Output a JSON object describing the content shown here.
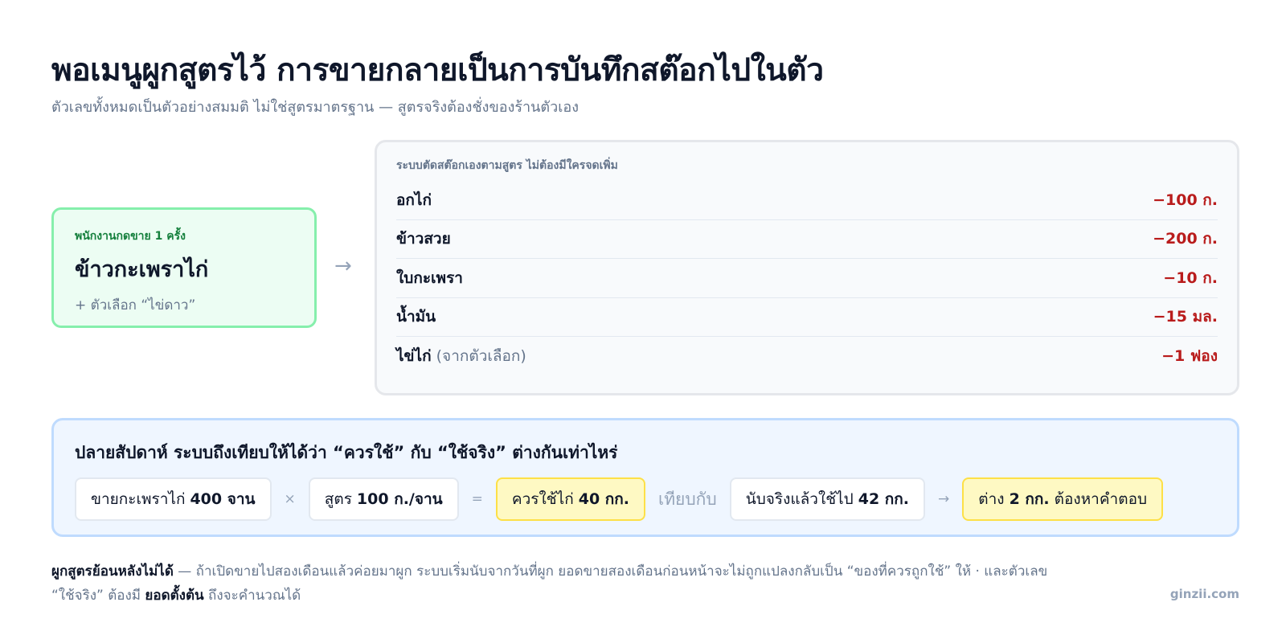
{
  "header": {
    "title": "พอเมนูผูกสูตรไว้ การขายกลายเป็นการบันทึกสต๊อกไปในตัว",
    "subtitle": "ตัวเลขทั้งหมดเป็นตัวอย่างสมมติ ไม่ใช่สูตรมาตรฐาน — สูตรจริงต้องชั่งของร้านตัวเอง"
  },
  "sale": {
    "kicker": "พนักงานกดขาย 1 ครั้ง",
    "dish": "ข้าวกะเพราไก่",
    "option": "+ ตัวเลือก “ไข่ดาว”",
    "arrow": "→"
  },
  "deduction": {
    "title": "ระบบตัดสต๊อกเองตามสูตร ไม่ต้องมีใครจดเพิ่ม",
    "rows": [
      {
        "name": "อกไก่",
        "note": "",
        "qty": "−100 ก."
      },
      {
        "name": "ข้าวสวย",
        "note": "",
        "qty": "−200 ก."
      },
      {
        "name": "ใบกะเพรา",
        "note": "",
        "qty": "−10 ก."
      },
      {
        "name": "น้ำมัน",
        "note": "",
        "qty": "−15 มล."
      },
      {
        "name": "ไข่ไก่",
        "note": " (จากตัวเลือก)",
        "qty": "−1 ฟอง"
      }
    ]
  },
  "compare": {
    "title": "ปลายสัปดาห์ ระบบถึงเทียบให้ได้ว่า “ควรใช้” กับ “ใช้จริง” ต่างกันเท่าไหร่",
    "sold": {
      "text": "ขายกะเพราไก่",
      "bold": "400 จาน"
    },
    "times": "×",
    "recipe": {
      "text": "สูตร",
      "bold": "100 ก./จาน"
    },
    "equals": "=",
    "expected": {
      "text": "ควรใช้ไก่",
      "bold": "40 กก."
    },
    "versus": "เทียบกับ",
    "actual": {
      "text": "นับจริงแล้วใช้ไป",
      "bold": "42 กก."
    },
    "arrow": "→",
    "diff": {
      "pre": "ต่าง",
      "bold": "2 กก.",
      "post": "ต้องหาคำตอบ"
    }
  },
  "footnote": {
    "bold1": "ผูกสูตรย้อนหลังไม่ได้",
    "text1": " — ถ้าเปิดขายไปสองเดือนแล้วค่อยมาผูก ระบบเริ่มนับจากวันที่ผูก ยอดขายสองเดือนก่อนหน้าจะไม่ถูกแปลงกลับเป็น “ของที่ควรถูกใช้” ให้ · และตัวเลข “ใช้จริง” ต้องมี ",
    "bold2": "ยอดตั้งต้น",
    "text2": " ถึงจะคำนวณได้"
  },
  "brand": "ginzii.com"
}
